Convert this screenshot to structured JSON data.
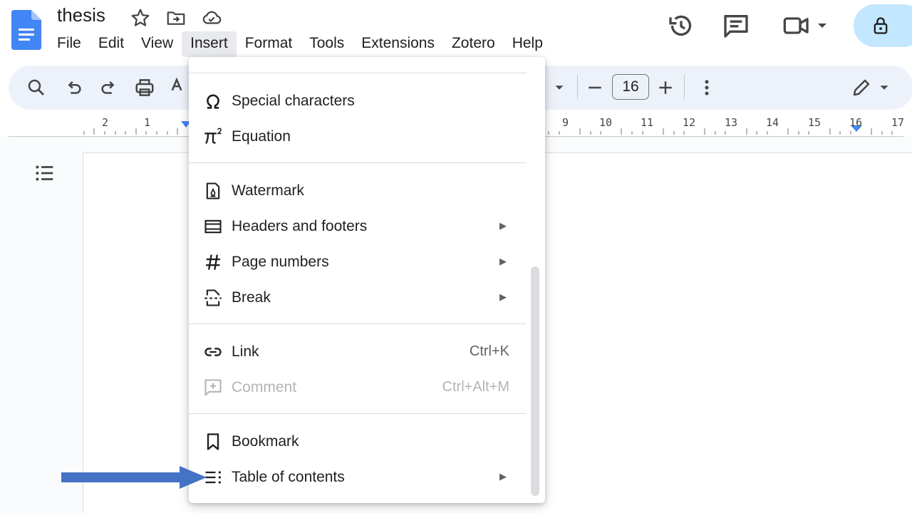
{
  "doc": {
    "title": "thesis"
  },
  "menubar": [
    "File",
    "Edit",
    "View",
    "Insert",
    "Format",
    "Tools",
    "Extensions",
    "Zotero",
    "Help"
  ],
  "active_menu": "Insert",
  "toolbar": {
    "font_size": "16"
  },
  "ruler": [
    "2",
    "1",
    "9",
    "10",
    "11",
    "12",
    "13",
    "14",
    "15",
    "16",
    "17"
  ],
  "insert_menu": {
    "special_characters": {
      "label": "Special characters",
      "icon": "omega-icon"
    },
    "equation": {
      "label": "Equation",
      "icon": "pi-squared-icon"
    },
    "watermark": {
      "label": "Watermark",
      "icon": "watermark-icon"
    },
    "headers_footers": {
      "label": "Headers and footers",
      "icon": "header-footer-icon"
    },
    "page_numbers": {
      "label": "Page numbers",
      "icon": "hash-icon"
    },
    "break": {
      "label": "Break",
      "icon": "break-icon"
    },
    "link": {
      "label": "Link",
      "shortcut": "Ctrl+K",
      "icon": "link-icon"
    },
    "comment": {
      "label": "Comment",
      "shortcut": "Ctrl+Alt+M",
      "icon": "comment-add-icon",
      "disabled": true
    },
    "bookmark": {
      "label": "Bookmark",
      "icon": "bookmark-icon"
    },
    "toc": {
      "label": "Table of contents",
      "icon": "toc-icon"
    },
    "submenu_glyph": "▶"
  },
  "colors": {
    "docs_blue": "#4285f4",
    "toolbar_bg": "#edf2fa",
    "share_bg": "#c2e7ff",
    "annotation_arrow": "#4472c4"
  }
}
